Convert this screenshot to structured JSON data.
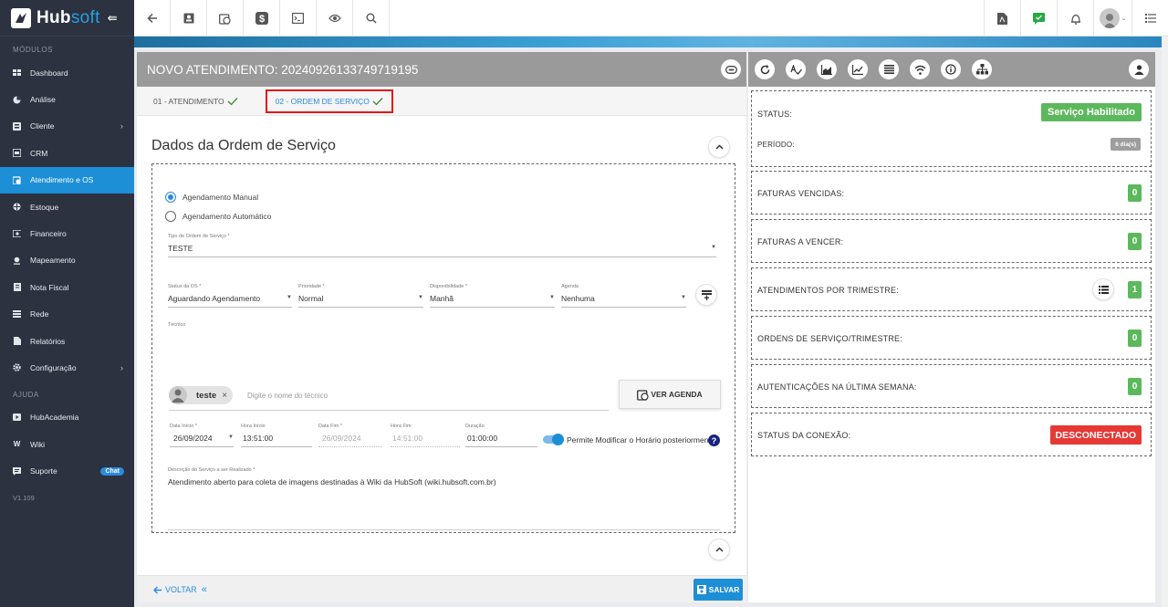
{
  "app": {
    "logo_name": "Hub",
    "logo_accent": "soft"
  },
  "sidebar": {
    "section_modules": "MÓDULOS",
    "items": [
      {
        "label": "Dashboard",
        "icon": "dashboard-icon"
      },
      {
        "label": "Análise",
        "icon": "pie-chart-icon"
      },
      {
        "label": "Cliente",
        "icon": "contact-card-icon"
      },
      {
        "label": "CRM",
        "icon": "crm-icon"
      },
      {
        "label": "Atendimento e OS",
        "icon": "calendar-clock-icon"
      },
      {
        "label": "Estoque",
        "icon": "box-icon"
      },
      {
        "label": "Financeiro",
        "icon": "money-icon"
      },
      {
        "label": "Mapeamento",
        "icon": "map-pin-icon"
      },
      {
        "label": "Nota Fiscal",
        "icon": "invoice-icon"
      },
      {
        "label": "Rede",
        "icon": "network-icon"
      },
      {
        "label": "Relatórios",
        "icon": "report-icon"
      },
      {
        "label": "Configuração",
        "icon": "gear-icon"
      }
    ],
    "section_help": "AJUDA",
    "help_items": [
      {
        "label": "HubAcademia",
        "icon": "video-icon"
      },
      {
        "label": "Wiki",
        "icon": "wiki-icon"
      },
      {
        "label": "Suporte",
        "icon": "chat-icon",
        "badge": "Chat"
      }
    ],
    "version": "V1.109"
  },
  "panel": {
    "title": "NOVO ATENDIMENTO: 20240926133749719195",
    "tab1": "01 - ATENDIMENTO",
    "tab2": "02 - ORDEM DE SERVIÇO",
    "section_title": "Dados da Ordem de Serviço",
    "radio_manual": "Agendamento Manual",
    "radio_auto": "Agendamento Automático",
    "tipo": {
      "label": "Tipo de Ordem de Serviço *",
      "value": "TESTE"
    },
    "status": {
      "label": "Status da OS *",
      "value": "Aguardando Agendamento"
    },
    "prioridade": {
      "label": "Prioridade *",
      "value": "Normal"
    },
    "disponibilidade": {
      "label": "Disponibilidade *",
      "value": "Manhã"
    },
    "agenda": {
      "label": "Agenda",
      "value": "Nenhuma"
    },
    "tecnico": {
      "label": "Técnico",
      "chip": "teste",
      "placeholder": "Digite o nome do técnico"
    },
    "ver_agenda": "VER AGENDA",
    "data_inicio": {
      "label": "Data Início *",
      "value": "26/09/2024"
    },
    "hora_inicio": {
      "label": "Hora Início",
      "value": "13:51:00"
    },
    "data_fim": {
      "label": "Data Fim *",
      "value": "26/09/2024"
    },
    "hora_fim": {
      "label": "Hora Fim",
      "value": "14:51:00"
    },
    "duracao": {
      "label": "Duração",
      "value": "01:00:00"
    },
    "toggle_label": "Permite Modificar o Horário posteriormente",
    "descricao": {
      "label": "Descrição do Serviço a ser Realizado *",
      "value": "Atendimento aberto para coleta de imagens destinadas à Wiki da HubSoft (wiki.hubsoft.com.br)"
    },
    "voltar": "VOLTAR",
    "salvar": "SALVAR"
  },
  "right": {
    "status_label": "STATUS:",
    "status_value": "Serviço Habilitado",
    "periodo_label": "PERÍODO:",
    "periodo_value": "6 dia(s)",
    "cards": [
      {
        "label": "FATURAS VENCIDAS:",
        "value": "0"
      },
      {
        "label": "FATURAS A VENCER:",
        "value": "0"
      },
      {
        "label": "ATENDIMENTOS POR TRIMESTRE:",
        "value": "1"
      },
      {
        "label": "ORDENS DE SERVIÇO/TRIMESTRE:",
        "value": "0"
      },
      {
        "label": "AUTENTICAÇÕES NA ÚLTIMA SEMANA:",
        "value": "0"
      }
    ],
    "conexao_label": "STATUS DA CONEXÃO:",
    "conexao_value": "DESCONECTADO"
  }
}
